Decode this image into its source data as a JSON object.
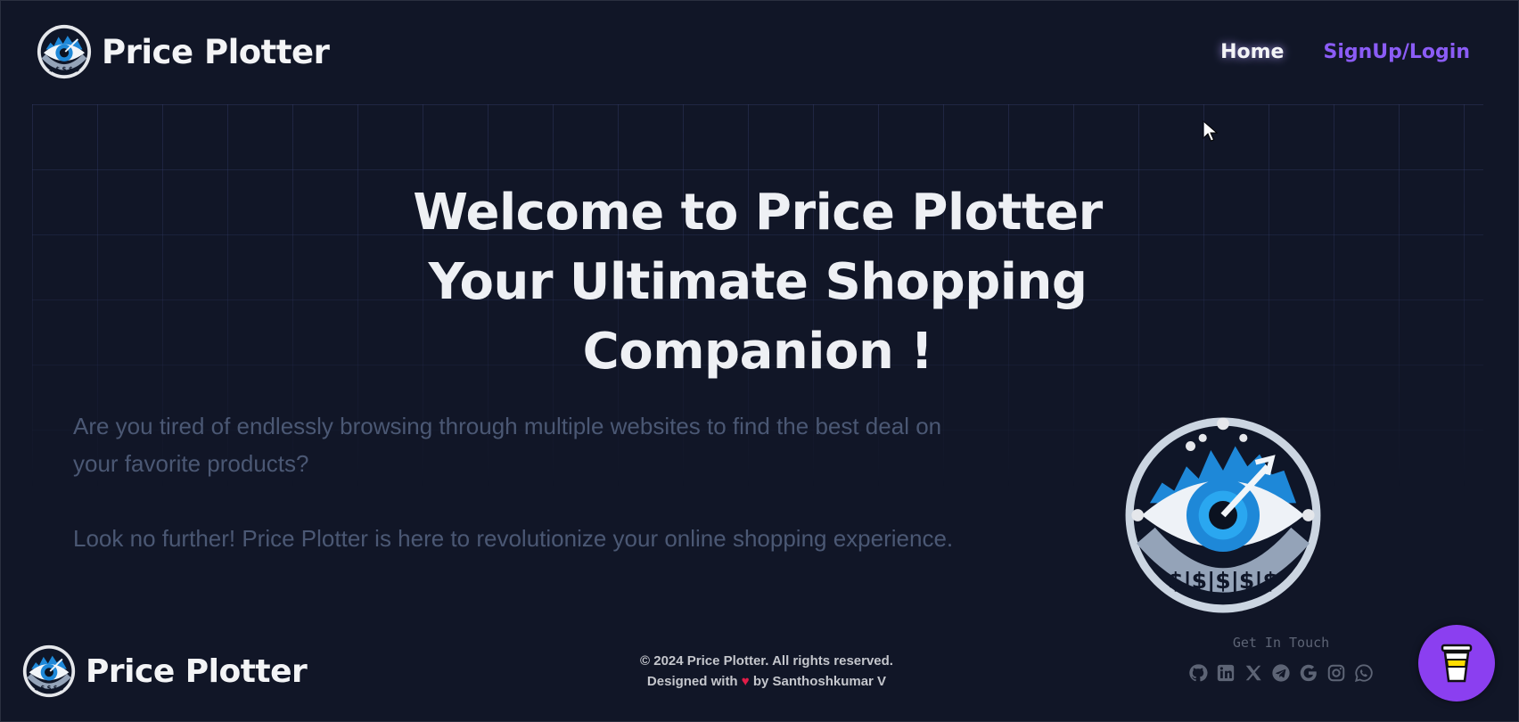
{
  "header": {
    "brand_name": "Price Plotter",
    "nav": {
      "home": "Home",
      "signup": "SignUp/Login"
    }
  },
  "hero": {
    "title_lines": [
      "Welcome to Price Plotter",
      "Your Ultimate Shopping",
      "Companion !"
    ],
    "paragraphs": [
      "Are you tired of endlessly browsing through multiple websites to find the best deal on your favorite products?",
      "Look no further! Price Plotter is here to revolutionize your online shopping experience."
    ]
  },
  "footer": {
    "brand_name": "Price Plotter",
    "copyright": "© 2024 Price Plotter. All rights reserved.",
    "credit_prefix": "Designed with",
    "credit_heart": "♥",
    "credit_suffix": "by Santhoshkumar V",
    "get_in_touch": "Get In Touch",
    "socials": [
      "github-icon",
      "linkedin-icon",
      "x-icon",
      "telegram-icon",
      "google-icon",
      "instagram-icon",
      "whatsapp-icon"
    ]
  },
  "colors": {
    "background": "#111627",
    "accent": "#8b5cf6",
    "coffee_button": "#8b3ff0"
  }
}
